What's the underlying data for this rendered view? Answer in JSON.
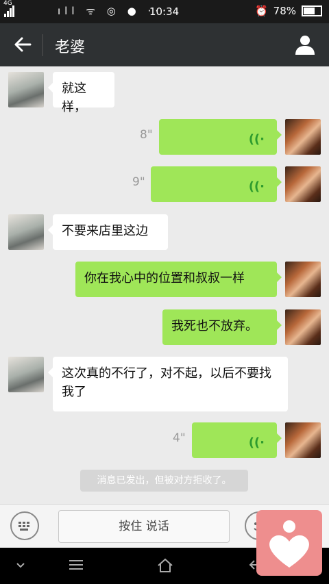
{
  "status": {
    "network": "4G",
    "time": "10:34",
    "battery": "78%",
    "battery_level": 0.78
  },
  "header": {
    "title": "老婆"
  },
  "messages": [
    {
      "from": "her",
      "type": "text",
      "text": "就这样，"
    },
    {
      "from": "me",
      "type": "voice",
      "duration": "8\""
    },
    {
      "from": "me",
      "type": "voice",
      "duration": "9\""
    },
    {
      "from": "her",
      "type": "text",
      "text": "不要来店里这边"
    },
    {
      "from": "me",
      "type": "text",
      "text": "你在我心中的位置和叔叔一样"
    },
    {
      "from": "me",
      "type": "text",
      "text": "我死也不放弃。"
    },
    {
      "from": "her",
      "type": "text",
      "text": "这次真的不行了，对不起，以后不要找我了"
    },
    {
      "from": "me",
      "type": "voice",
      "duration": "4\""
    }
  ],
  "notice": "消息已发出，但被对方拒收了。",
  "input": {
    "hold_to_talk": "按住 说话"
  },
  "colors": {
    "out_bubble": "#9fe658",
    "in_bubble": "#ffffff",
    "titlebar": "#2e3133"
  }
}
